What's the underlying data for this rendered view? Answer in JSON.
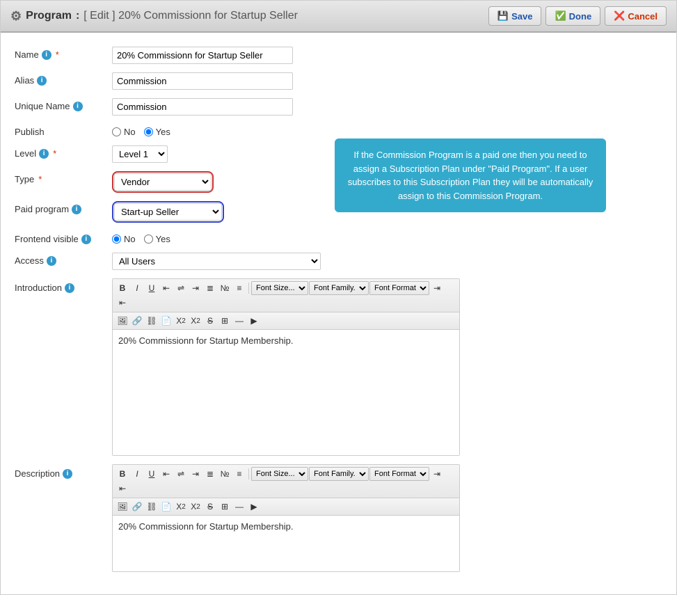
{
  "header": {
    "icon": "⚙",
    "title": "Program",
    "separator": ":",
    "subtitle": "[ Edit ] 20% Commissionn for Startup Seller",
    "save_label": "Save",
    "done_label": "Done",
    "cancel_label": "Cancel"
  },
  "form": {
    "name_label": "Name",
    "name_value": "20% Commissionn for Startup Seller",
    "alias_label": "Alias",
    "alias_value": "Commission",
    "unique_name_label": "Unique Name",
    "unique_name_value": "Commission",
    "publish_label": "Publish",
    "publish_no": "No",
    "publish_yes": "Yes",
    "level_label": "Level",
    "level_value": "Level 1",
    "type_label": "Type",
    "type_value": "Vendor",
    "paid_program_label": "Paid program",
    "paid_program_value": "Start-up Seller",
    "frontend_visible_label": "Frontend visible",
    "frontend_no": "No",
    "frontend_yes": "Yes",
    "access_label": "Access",
    "access_value": "All Users",
    "introduction_label": "Introduction",
    "intro_content": "20% Commissionn for Startup Membership.",
    "description_label": "Description",
    "desc_content": "20% Commissionn for Startup Membership.",
    "tooltip": "If the Commission Program is a paid one then you need to assign a Subscription Plan under \"Paid Program\". If a user subscribes to this Subscription Plan they will be automatically assign to this Commission Program.",
    "font_size_label": "Font Size...",
    "font_family_label": "Font Family.",
    "font_format_label": "Font Format"
  }
}
